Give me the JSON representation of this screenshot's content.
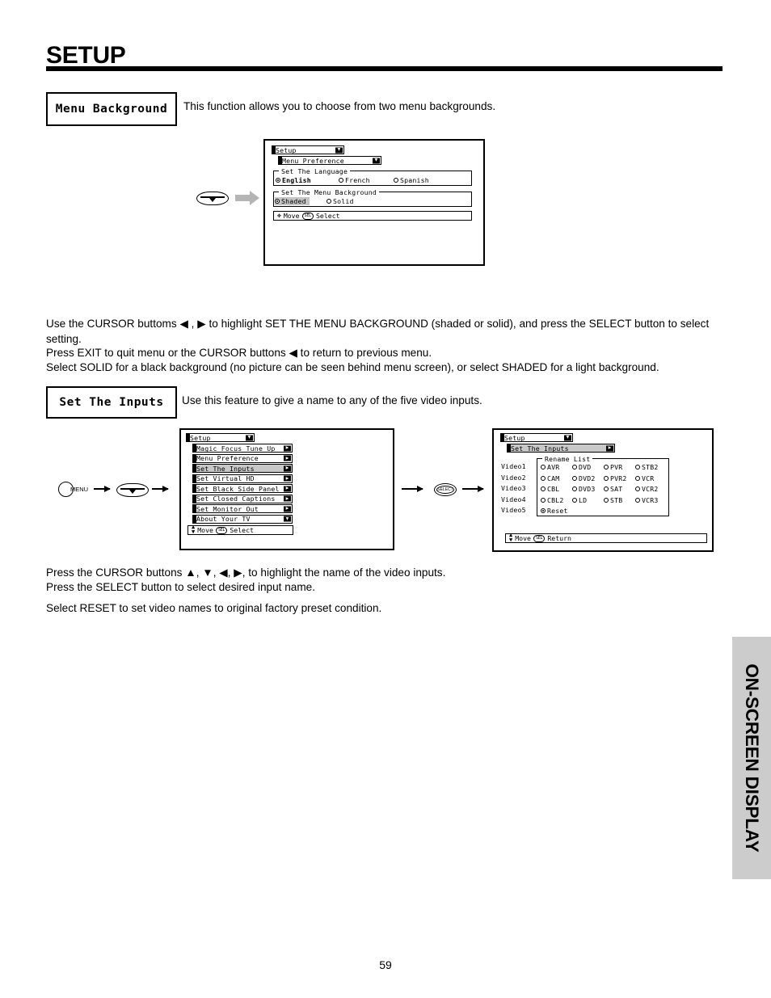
{
  "header": {
    "title": "SETUP"
  },
  "page_number": "59",
  "side_tab": {
    "label": "ON-SCREEN DISPLAY"
  },
  "sections": [
    {
      "feature_label": "Menu Background",
      "description": "This function allows you to choose from two menu backgrounds.",
      "notes": [
        "Use the CURSOR buttoms ◀ , ▶ to highlight SET THE MENU BACKGROUND (shaded or solid), and press the SELECT button to select setting.",
        "Press EXIT to quit menu or the CURSOR buttons ◀ to return to previous menu.",
        "Select SOLID for a black background (no picture can be seen behind menu screen), or select SHADED for a light background."
      ]
    },
    {
      "feature_label": "Set The Inputs",
      "description": "Use this feature to give a name to any of the five video inputs.",
      "notes": [
        "Press the CURSOR buttons ▲, ▼, ◀, ▶, to highlight the name of the video inputs.",
        "Press the SELECT button to select desired input name.",
        "Select RESET to set video names to original factory preset condition."
      ]
    }
  ],
  "osd_menu_preference": {
    "title_bar": "Setup",
    "sub_bar": "Menu Preference",
    "language_group": {
      "legend": "Set The Language",
      "options": [
        {
          "label": "English",
          "selected": true
        },
        {
          "label": "French",
          "selected": false
        },
        {
          "label": "Spanish",
          "selected": false
        }
      ]
    },
    "background_group": {
      "legend": "Set The Menu Background",
      "options": [
        {
          "label": "Shaded",
          "selected": true,
          "highlighted": true
        },
        {
          "label": "Solid",
          "selected": false,
          "highlighted": false
        }
      ]
    },
    "help": {
      "move": "Move",
      "select_key": "SEL",
      "select": "Select"
    }
  },
  "osd_setup_list": {
    "title_bar": "Setup",
    "items": [
      {
        "label": "Magic Focus Tune Up",
        "highlighted": false
      },
      {
        "label": "Menu Preference",
        "highlighted": false
      },
      {
        "label": "Set The Inputs",
        "highlighted": true
      },
      {
        "label": "Set Virtual HD",
        "highlighted": false
      },
      {
        "label": "Set Black Side Panel",
        "highlighted": false
      },
      {
        "label": "Set Closed Captions",
        "highlighted": false
      },
      {
        "label": "Set Monitor Out",
        "highlighted": false
      },
      {
        "label": "About Your TV",
        "highlighted": false
      }
    ],
    "help": {
      "move": "Move",
      "select_key": "SEL",
      "select": "Select"
    }
  },
  "osd_rename": {
    "title_bar": "Setup",
    "sub_bar": "Set The Inputs",
    "group_legend": "Rename List",
    "video_labels": [
      "Video1",
      "Video2",
      "Video3",
      "Video4",
      "Video5"
    ],
    "columns": [
      [
        {
          "label": "AVR",
          "selected": false
        },
        {
          "label": "CAM",
          "selected": false
        },
        {
          "label": "CBL",
          "selected": false
        },
        {
          "label": "CBL2",
          "selected": false
        },
        {
          "label": "Reset",
          "selected": true
        }
      ],
      [
        {
          "label": "DVD",
          "selected": false
        },
        {
          "label": "DVD2",
          "selected": false
        },
        {
          "label": "DVD3",
          "selected": false
        },
        {
          "label": "LD",
          "selected": false
        }
      ],
      [
        {
          "label": "PVR",
          "selected": false
        },
        {
          "label": "PVR2",
          "selected": false
        },
        {
          "label": "SAT",
          "selected": false
        },
        {
          "label": "STB",
          "selected": false
        }
      ],
      [
        {
          "label": "STB2",
          "selected": false
        },
        {
          "label": "VCR",
          "selected": false
        },
        {
          "label": "VCR2",
          "selected": false
        },
        {
          "label": "VCR3",
          "selected": false
        }
      ]
    ],
    "help": {
      "move": "Move",
      "select_key": "SEL",
      "return": "Return"
    }
  },
  "remote": {
    "menu_label": "MENU",
    "select_label": "SELECT"
  }
}
